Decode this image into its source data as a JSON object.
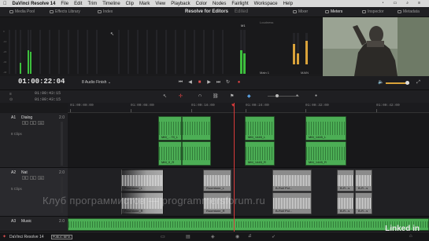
{
  "menubar": {
    "app": "DaVinci Resolve 14",
    "items": [
      "File",
      "Edit",
      "Trim",
      "Timeline",
      "Clip",
      "Mark",
      "View",
      "Playback",
      "Color",
      "Nodes",
      "Fairlight",
      "Workspace",
      "Help"
    ]
  },
  "toolbar": {
    "media_pool": "Media Pool",
    "effects_library": "Effects Library",
    "index": "Index",
    "title": "Resolve for Editors",
    "title_status": "Edited",
    "mixer": "Mixer",
    "meters": "Meters",
    "inspector": "Inspector",
    "metadata": "Metadata"
  },
  "meters_panel": {
    "bus_label": "M1",
    "main_label": "Main 1",
    "main2_label": "MAIN",
    "loudness_label": "Loudness"
  },
  "transport": {
    "timecode": "01:00:22:04",
    "track_name": "8 Audio Finish"
  },
  "edit_tools": {
    "tc_in": "01:00:43:15",
    "tc_out": "01:00:43:15"
  },
  "ruler": {
    "ticks": [
      "01:00:00:00",
      "01:00:08:00",
      "01:00:16:00",
      "01:00:24:00",
      "01:00:32:00",
      "01:00:42:00"
    ]
  },
  "tracks": [
    {
      "id": "A1",
      "name": "Dialog",
      "value": "2.0",
      "clips": "8 Clips"
    },
    {
      "id": "A2",
      "name": "Nat",
      "value": "2.0",
      "clips": "5 Clips"
    },
    {
      "id": "A3",
      "name": "Music",
      "value": "2.0",
      "clips": ""
    }
  ],
  "track_buttons": [
    "R",
    "S",
    "M"
  ],
  "clips": {
    "a1": [
      "MM_...79_L",
      "MM_1445_L",
      "MM_1445_L",
      "MM_0_R",
      "MM_1445_R",
      "MM_1445_R"
    ],
    "a2": [
      "Roomtone_L",
      "Roomtone_L",
      "B-Roll Pol...",
      "B-R...s",
      "B-R...s",
      "Roomtone_R",
      "Roomtone_R",
      "B-Roll Pol...",
      "B-R...s",
      "B-R...s"
    ]
  },
  "pagebar": {
    "brand": "DaVinci Resolve 14",
    "beta": "PUBLIC BETA"
  },
  "watermark": "Клуб программистов — programmersforum.ru",
  "linkedin": "Linked in"
}
